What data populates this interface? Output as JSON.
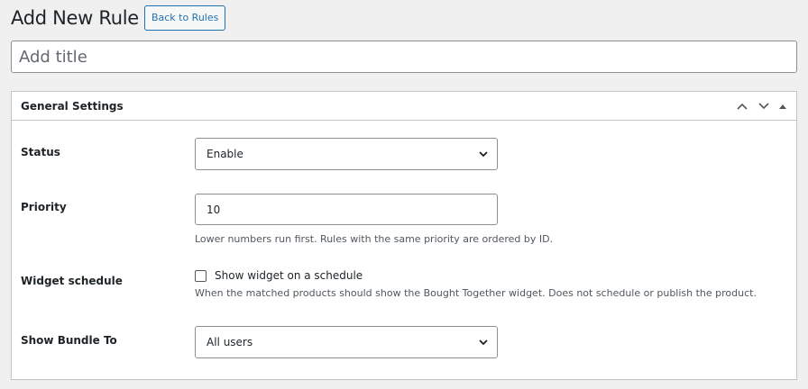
{
  "header": {
    "page_title": "Add New Rule",
    "back_button_label": "Back to Rules"
  },
  "title_field": {
    "placeholder": "Add title",
    "value": ""
  },
  "general_settings": {
    "title": "General Settings",
    "handle_icons": [
      "chevron-up-icon",
      "chevron-down-icon",
      "triangle-up-icon"
    ],
    "fields": {
      "status": {
        "label": "Status",
        "selected": "Enable"
      },
      "priority": {
        "label": "Priority",
        "value": "10",
        "description": "Lower numbers run first. Rules with the same priority are ordered by ID."
      },
      "widget_schedule": {
        "label": "Widget schedule",
        "checkbox_label": "Show widget on a schedule",
        "checked": false,
        "description": "When the matched products should show the Bought Together widget. Does not schedule or publish the product."
      },
      "show_bundle_to": {
        "label": "Show Bundle To",
        "selected": "All users"
      }
    }
  },
  "colors": {
    "accent": "#2271b1",
    "background": "#f0f0f1",
    "border": "#c3c4c7",
    "text": "#1d2327"
  }
}
